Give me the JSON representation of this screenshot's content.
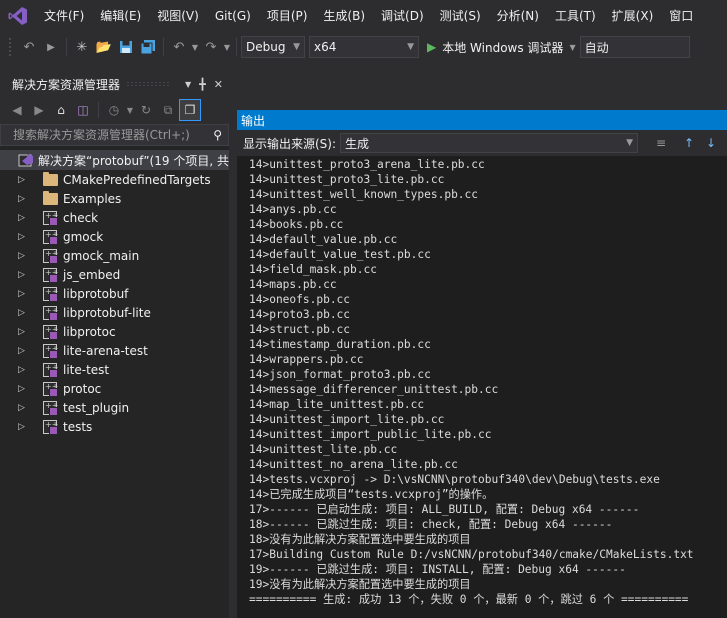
{
  "menu": {
    "items": [
      "文件(F)",
      "编辑(E)",
      "视图(V)",
      "Git(G)",
      "项目(P)",
      "生成(B)",
      "调试(D)",
      "测试(S)",
      "分析(N)",
      "工具(T)",
      "扩展(X)",
      "窗口"
    ]
  },
  "toolbar": {
    "configuration": "Debug",
    "platform": "x64",
    "run_label": "本地 Windows 调试器",
    "run_mode": "自动"
  },
  "solution_explorer": {
    "title": "解决方案资源管理器",
    "search_placeholder": "搜索解决方案资源管理器(Ctrl+;)",
    "solution_label": "解决方案“protobuf”(19 个项目, 共",
    "items": [
      {
        "label": "CMakePredefinedTargets",
        "type": "folder"
      },
      {
        "label": "Examples",
        "type": "folder"
      },
      {
        "label": "check",
        "type": "project"
      },
      {
        "label": "gmock",
        "type": "project"
      },
      {
        "label": "gmock_main",
        "type": "project"
      },
      {
        "label": "js_embed",
        "type": "project"
      },
      {
        "label": "libprotobuf",
        "type": "project"
      },
      {
        "label": "libprotobuf-lite",
        "type": "project"
      },
      {
        "label": "libprotoc",
        "type": "project"
      },
      {
        "label": "lite-arena-test",
        "type": "project"
      },
      {
        "label": "lite-test",
        "type": "project"
      },
      {
        "label": "protoc",
        "type": "project"
      },
      {
        "label": "test_plugin",
        "type": "project"
      },
      {
        "label": "tests",
        "type": "project"
      }
    ]
  },
  "output": {
    "title": "输出",
    "source_label": "显示输出来源(S):",
    "source_value": "生成",
    "lines": [
      "14>unittest_proto3_arena_lite.pb.cc",
      "14>unittest_proto3_lite.pb.cc",
      "14>unittest_well_known_types.pb.cc",
      "14>anys.pb.cc",
      "14>books.pb.cc",
      "14>default_value.pb.cc",
      "14>default_value_test.pb.cc",
      "14>field_mask.pb.cc",
      "14>maps.pb.cc",
      "14>oneofs.pb.cc",
      "14>proto3.pb.cc",
      "14>struct.pb.cc",
      "14>timestamp_duration.pb.cc",
      "14>wrappers.pb.cc",
      "14>json_format_proto3.pb.cc",
      "14>message_differencer_unittest.pb.cc",
      "14>map_lite_unittest.pb.cc",
      "14>unittest_import_lite.pb.cc",
      "14>unittest_import_public_lite.pb.cc",
      "14>unittest_lite.pb.cc",
      "14>unittest_no_arena_lite.pb.cc",
      "14>tests.vcxproj -> D:\\vsNCNN\\protobuf340\\dev\\Debug\\tests.exe",
      "14>已完成生成项目“tests.vcxproj”的操作。",
      "17>------ 已启动生成: 项目: ALL_BUILD, 配置: Debug x64 ------",
      "18>------ 已跳过生成: 项目: check, 配置: Debug x64 ------",
      "18>没有为此解决方案配置选中要生成的项目",
      "17>Building Custom Rule D:/vsNCNN/protobuf340/cmake/CMakeLists.txt",
      "19>------ 已跳过生成: 项目: INSTALL, 配置: Debug x64 ------",
      "19>没有为此解决方案配置选中要生成的项目",
      "========== 生成: 成功 13 个，失败 0 个，最新 0 个，跳过 6 个 =========="
    ]
  },
  "colors": {
    "accent": "#007acc",
    "background": "#2d2d30",
    "panel": "#252526",
    "editor": "#1e1e1e",
    "vs_purple": "#865fc5"
  }
}
